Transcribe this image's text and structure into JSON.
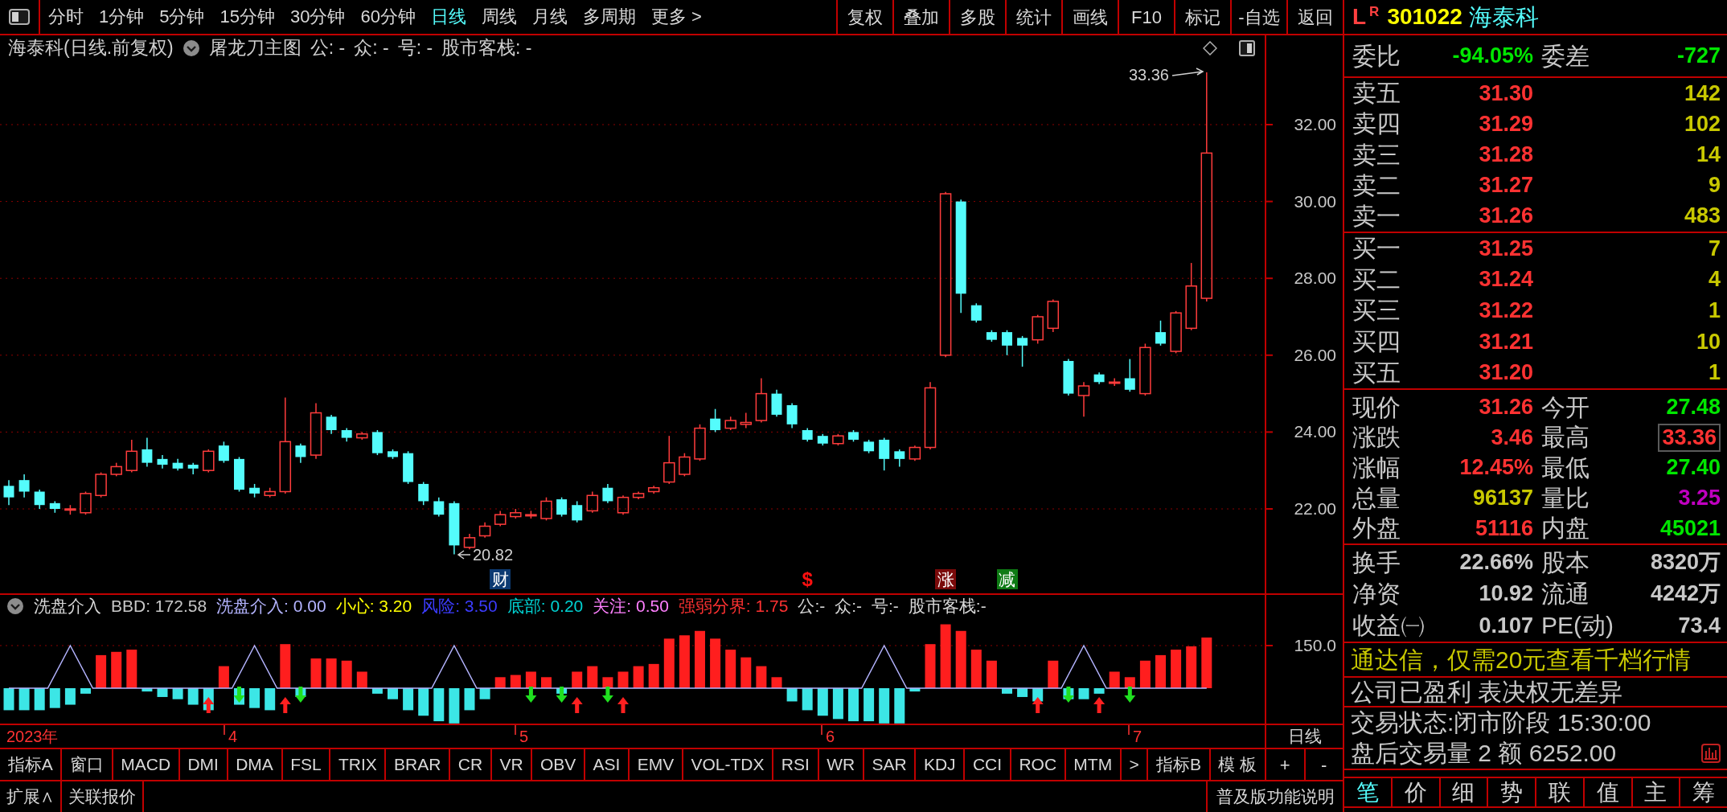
{
  "toolbar": {
    "periods": [
      {
        "label": "分时",
        "selected": false
      },
      {
        "label": "1分钟",
        "selected": false
      },
      {
        "label": "5分钟",
        "selected": false
      },
      {
        "label": "15分钟",
        "selected": false
      },
      {
        "label": "30分钟",
        "selected": false
      },
      {
        "label": "60分钟",
        "selected": false
      },
      {
        "label": "日线",
        "selected": true
      },
      {
        "label": "周线",
        "selected": false
      },
      {
        "label": "月线",
        "selected": false
      },
      {
        "label": "多周期",
        "selected": false
      },
      {
        "label": "更多 >",
        "selected": false
      }
    ],
    "buttons": [
      "复权",
      "叠加",
      "多股",
      "统计",
      "画线",
      "F10",
      "标记",
      "-自选",
      "返回"
    ]
  },
  "chart": {
    "title": "海泰科(日线.前复权)",
    "indicator": "屠龙刀主图",
    "params": [
      "公: -",
      "众: -",
      "号: -",
      "股市客栈: -"
    ],
    "price_ticks": [
      "32.00",
      "30.00",
      "28.00",
      "26.00",
      "24.00",
      "22.00"
    ],
    "high_label": "33.36",
    "low_label": "20.82",
    "event_markers": [
      {
        "label": "财",
        "kind": "badge",
        "color": "#0c3a72"
      },
      {
        "label": "$",
        "kind": "symbol",
        "color": "#ff1010"
      },
      {
        "label": "涨",
        "kind": "badge",
        "color": "#7a0a0a"
      },
      {
        "label": "减",
        "kind": "badge",
        "color": "#0e7a14"
      }
    ]
  },
  "indicator_panel": {
    "name": "洗盘介入",
    "readings": [
      {
        "text": "BBD: 172.58",
        "color": "#c8c8c8"
      },
      {
        "text": "洗盘介入: 0.00",
        "color": "#b4b4ff"
      },
      {
        "text": "小心: 3.20",
        "color": "#ffff00"
      },
      {
        "text": "风险: 3.50",
        "color": "#3c3cff"
      },
      {
        "text": "底部: 0.20",
        "color": "#00d2d2"
      },
      {
        "text": "关注: 0.50",
        "color": "#ff80ff"
      },
      {
        "text": "强弱分界: 1.75",
        "color": "#ff3232"
      }
    ],
    "params": [
      "公:-",
      "众:-",
      "号:-",
      "股市客栈:-"
    ],
    "ticks": [
      "150.0"
    ]
  },
  "date_axis": {
    "labels": [
      "2023年",
      "4",
      "5",
      "6",
      "7"
    ],
    "period": "日线"
  },
  "indicator_tabs": [
    "指标A",
    "窗口",
    "MACD",
    "DMI",
    "DMA",
    "FSL",
    "TRIX",
    "BRAR",
    "CR",
    "VR",
    "OBV",
    "ASI",
    "EMV",
    "VOL-TDX",
    "RSI",
    "WR",
    "SAR",
    "KDJ",
    "CCI",
    "ROC",
    "MTM",
    ">",
    "指标B",
    "模 板"
  ],
  "zoom_buttons": [
    "+",
    "-"
  ],
  "bottom_bar": {
    "tabs": [
      "扩展∧",
      "关联报价"
    ],
    "help": "普及版功能说明"
  },
  "quote": {
    "market": "L",
    "flag": "R",
    "code": "301022",
    "name": "海泰科",
    "order_ratio": {
      "cells": [
        {
          "label": "委比",
          "value": "-94.05%",
          "color": "#00e600"
        },
        {
          "label": "委差",
          "value": "-727",
          "color": "#00e600"
        }
      ]
    },
    "asks": [
      {
        "label": "卖五",
        "price": "31.30",
        "volume": "142"
      },
      {
        "label": "卖四",
        "price": "31.29",
        "volume": "102"
      },
      {
        "label": "卖三",
        "price": "31.28",
        "volume": "14"
      },
      {
        "label": "卖二",
        "price": "31.27",
        "volume": "9"
      },
      {
        "label": "卖一",
        "price": "31.26",
        "volume": "483"
      }
    ],
    "bids": [
      {
        "label": "买一",
        "price": "31.25",
        "volume": "7"
      },
      {
        "label": "买二",
        "price": "31.24",
        "volume": "4"
      },
      {
        "label": "买三",
        "price": "31.22",
        "volume": "1"
      },
      {
        "label": "买四",
        "price": "31.21",
        "volume": "10"
      },
      {
        "label": "买五",
        "price": "31.20",
        "volume": "1"
      }
    ],
    "stats": [
      {
        "cells": [
          {
            "label": "现价",
            "value": "31.26",
            "color": "#ff3232",
            "framed": false
          },
          {
            "label": "今开",
            "value": "27.48",
            "color": "#00e600",
            "framed": false
          }
        ]
      },
      {
        "cells": [
          {
            "label": "涨跌",
            "value": "3.46",
            "color": "#ff3232",
            "framed": false
          },
          {
            "label": "最高",
            "value": "33.36",
            "color": "#ff3232",
            "framed": true
          }
        ]
      },
      {
        "cells": [
          {
            "label": "涨幅",
            "value": "12.45%",
            "color": "#ff3232",
            "framed": false
          },
          {
            "label": "最低",
            "value": "27.40",
            "color": "#00e600",
            "framed": false
          }
        ]
      },
      {
        "cells": [
          {
            "label": "总量",
            "value": "96137",
            "color": "#c8c800",
            "framed": false
          },
          {
            "label": "量比",
            "value": "3.25",
            "color": "#c000c0",
            "framed": false
          }
        ]
      },
      {
        "cells": [
          {
            "label": "外盘",
            "value": "51116",
            "color": "#ff3232",
            "framed": false
          },
          {
            "label": "内盘",
            "value": "45021",
            "color": "#00e600",
            "framed": false
          }
        ]
      }
    ],
    "fundamentals": [
      {
        "cells": [
          {
            "label": "换手",
            "value": "22.66%"
          },
          {
            "label": "股本",
            "value": "8320万"
          }
        ]
      },
      {
        "cells": [
          {
            "label": "净资",
            "value": "10.92"
          },
          {
            "label": "流通",
            "value": "4242万"
          }
        ]
      },
      {
        "cells": [
          {
            "label": "收益㈠",
            "value": "0.107"
          },
          {
            "label": "PE(动)",
            "value": "73.4"
          }
        ]
      }
    ],
    "ad": "通达信，仅需20元查看千档行情",
    "notice": "公司已盈利 表决权无差异",
    "status": "交易状态:闭市阶段 15:30:00",
    "after_hours": "盘后交易量 2 额 6252.00",
    "tabs": [
      {
        "label": "笔",
        "selected": true
      },
      {
        "label": "价",
        "selected": false
      },
      {
        "label": "细",
        "selected": false
      },
      {
        "label": "势",
        "selected": false
      },
      {
        "label": "联",
        "selected": false
      },
      {
        "label": "值",
        "selected": false
      },
      {
        "label": "主",
        "selected": false
      },
      {
        "label": "筹",
        "selected": false
      }
    ]
  }
}
